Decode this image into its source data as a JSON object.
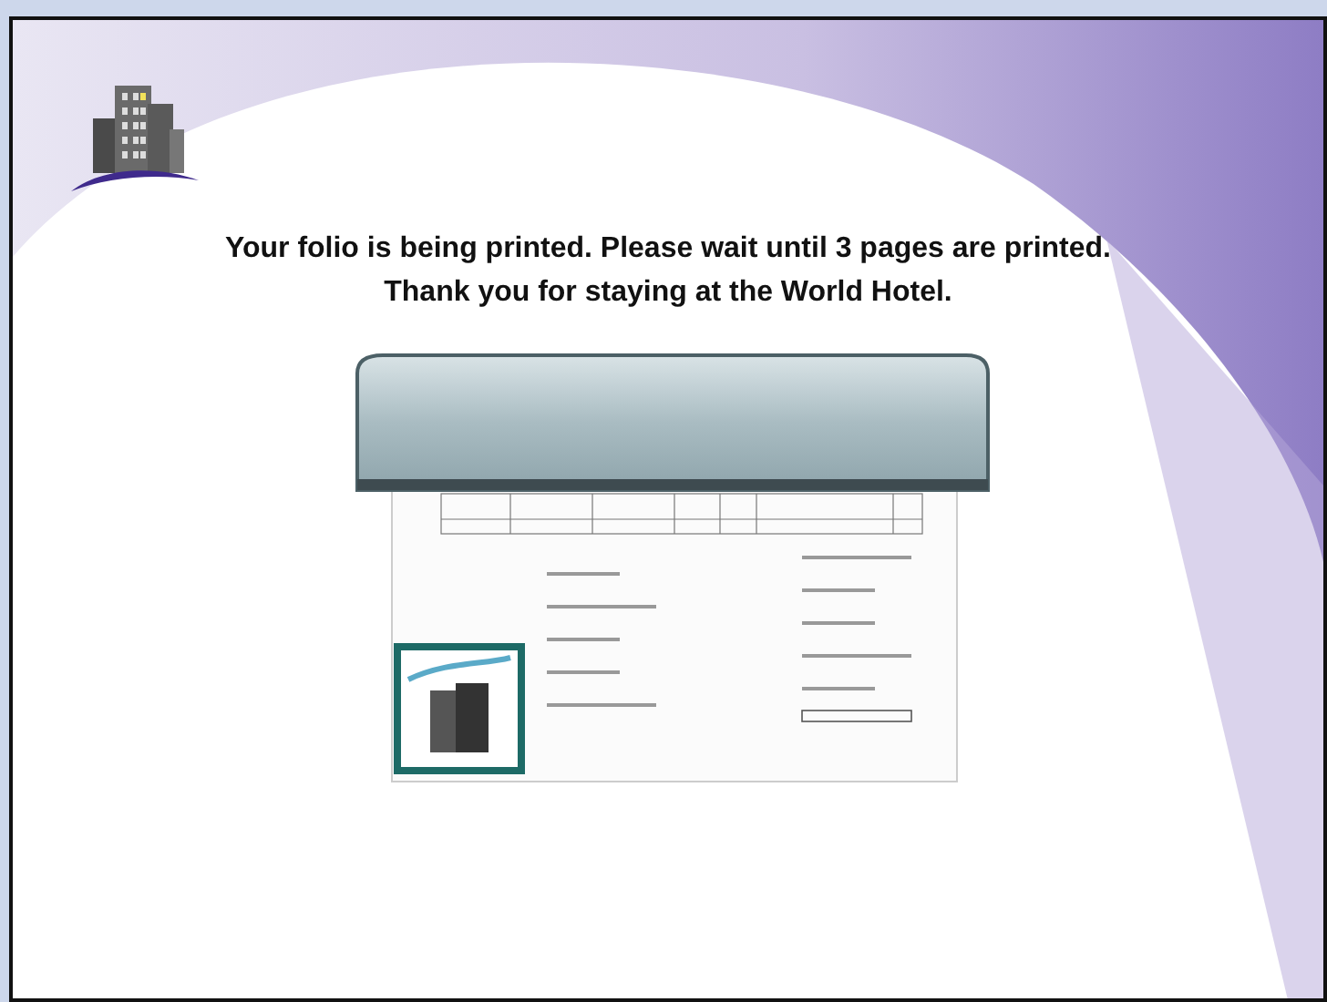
{
  "message": {
    "lines": [
      "Your folio is being printed. Please wait until 3 pages are printed.",
      "Thank you for staying at the World Hotel."
    ]
  }
}
